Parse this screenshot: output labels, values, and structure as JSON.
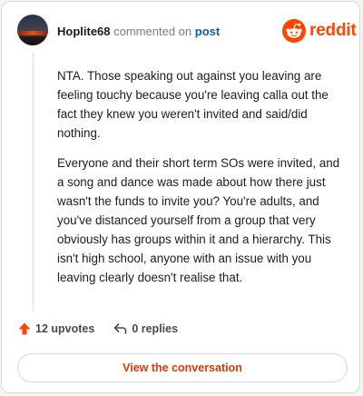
{
  "comment": {
    "username": "Hoplite68",
    "action_text": "commented on",
    "post_link_text": "post",
    "paragraphs": [
      "NTA. Those speaking out against you leaving are feeling touchy because you're leaving calla out the fact they knew you weren't invited and said/did nothing.",
      "Everyone and their short term SOs were invited, and a song and dance was made about how there just wasn't the funds to invite you? You're adults, and you've distanced yourself from a group that very obviously has groups within it and a hierarchy. This isn't high school, anyone with an issue with you leaving clearly doesn't realise that."
    ],
    "upvotes_label": "12 upvotes",
    "replies_label": "0 replies"
  },
  "brand": {
    "wordmark": "reddit",
    "color": "#ff4500"
  },
  "cta": {
    "label": "View the conversation",
    "color": "#d93a00"
  },
  "icons": {
    "avatar": "sunset-landscape-avatar",
    "logo": "reddit-snoo-logo",
    "upvote": "upvote-arrow-icon",
    "reply": "reply-arrow-icon"
  }
}
